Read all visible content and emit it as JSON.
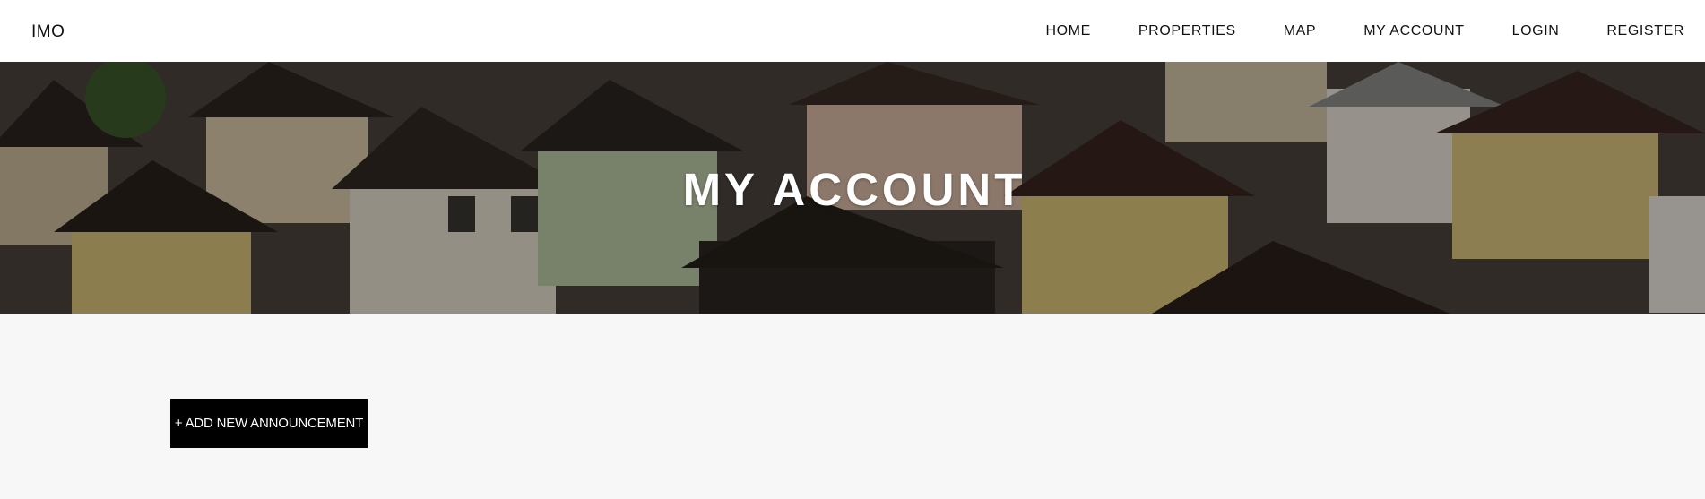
{
  "header": {
    "logo": "IMO",
    "nav": [
      "HOME",
      "PROPERTIES",
      "MAP",
      "MY ACCOUNT",
      "LOGIN",
      "REGISTER"
    ]
  },
  "hero": {
    "title": "MY ACCOUNT",
    "background_image": "houses-rooftops-aerial"
  },
  "main": {
    "add_button_label": "+ ADD NEW ANNOUNCEMENT"
  },
  "colors": {
    "navbar_bg": "#ffffff",
    "page_bg": "#f7f7f7",
    "button_bg": "#000000",
    "hero_text": "#ffffff"
  }
}
